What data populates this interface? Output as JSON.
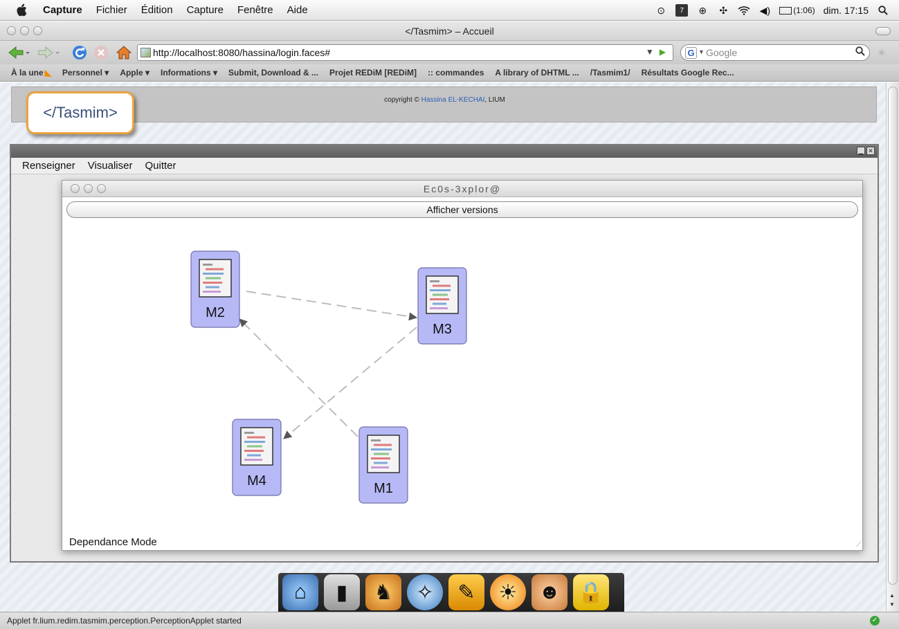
{
  "menubar": {
    "app_name": "Capture",
    "items": [
      "Fichier",
      "Édition",
      "Capture",
      "Fenêtre",
      "Aide"
    ],
    "battery": "(1:06)",
    "clock": "dim. 17:15"
  },
  "window": {
    "title": "</Tasmim> – Accueil"
  },
  "toolbar": {
    "url": "http://localhost:8080/hassina/login.faces#",
    "search_placeholder": "Google"
  },
  "bookmarks": [
    "À la une",
    "Personnel ▾",
    "Apple ▾",
    "Informations ▾",
    "Submit, Download & ...",
    "Projet REDiM [REDiM]",
    ":: commandes",
    "A library of DHTML ...",
    "/Tasmim1/",
    "Résultats Google Rec..."
  ],
  "page": {
    "logo_text": "</Tasmim>",
    "copyright_prefix": "copyright ©",
    "copyright_author": "Hassina EL-KECHAI",
    "copyright_suffix": ", LIUM"
  },
  "applet": {
    "menu": [
      "Renseigner",
      "Visualiser",
      "Quitter"
    ],
    "inner_title": "Ec0s-3xplor@",
    "versions_button": "Afficher versions",
    "mode_label": "Dependance Mode",
    "nodes": [
      {
        "id": "M2",
        "label": "M2"
      },
      {
        "id": "M3",
        "label": "M3"
      },
      {
        "id": "M4",
        "label": "M4"
      },
      {
        "id": "M1",
        "label": "M1"
      }
    ],
    "edges": [
      {
        "from": "M2",
        "to": "M3"
      },
      {
        "from": "M3",
        "to": "M4"
      },
      {
        "from": "M1",
        "to": "M2"
      }
    ]
  },
  "status": {
    "text": "Applet fr.lium.redim.tasmim.perception.PerceptionApplet started"
  },
  "colors": {
    "node_fill": "#b7b9f6",
    "edge": "#bdbdbd",
    "logo_border": "#e9a33f"
  }
}
